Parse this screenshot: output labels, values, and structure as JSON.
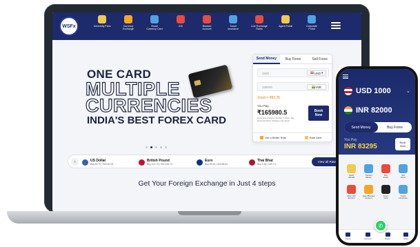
{
  "site": {
    "logo_text": "WSFx"
  },
  "nav": {
    "items": [
      {
        "label": "University Fees",
        "icon": "university-icon",
        "color": "#f2c94c"
      },
      {
        "label": "Currency\nExchange",
        "icon": "coins-icon",
        "color": "#f5a623"
      },
      {
        "label": "Smart\nCurrency Card",
        "icon": "card-icon",
        "color": "#4fa3e0"
      },
      {
        "label": "GIC",
        "icon": "handshake-icon",
        "color": "#e94b3c"
      },
      {
        "label": "Blocked\nAccount",
        "icon": "euro-icon",
        "color": "#e94b3c"
      },
      {
        "label": "Travel\nInsurance",
        "icon": "shield-icon",
        "color": "#4fa3e0"
      },
      {
        "label": "Live Exchange\nRates",
        "icon": "chart-icon",
        "color": "#e94b3c"
      },
      {
        "label": "Agent Portal",
        "icon": "agent-icon",
        "color": "#f2c94c"
      },
      {
        "label": "Corporate\nPortal",
        "icon": "building-icon",
        "color": "#4fa3e0"
      }
    ]
  },
  "hero": {
    "line1": "ONE CARD",
    "line2": "MULTIPLE",
    "line3": "CURRENCIES",
    "line4": "INDIA'S BEST FOREX CARD"
  },
  "widget": {
    "tabs": [
      "Send Money",
      "Buy Forex",
      "Sell Forex"
    ],
    "send_placeholder": "3600",
    "send_currency": "USD",
    "receive_placeholder": "338000",
    "receive_currency": "INR",
    "rate": "1Usd = ₹82.25",
    "you_pay_label": "You Pay",
    "you_pay_value": "₹165980.5",
    "fine_print": "Excluding charges (Charge ₹ 400+) Tax, Documentation Charges may Apply",
    "book_label": "Book\nNow",
    "better_rate": "Get a Better Rate",
    "rate_alert": "Rate Alert"
  },
  "rates": [
    {
      "name": "US Dollar",
      "values": "Buy 82.75 | Sell 82.25",
      "color": "#3c5fb0"
    },
    {
      "name": "British Pound",
      "values": "Buy 101.70 | Sell 100.74",
      "color": "#c8102e"
    },
    {
      "name": "Euro",
      "values": "Buy 89.40 | Sell 88.64",
      "color": "#003399"
    },
    {
      "name": "Thai Bhat",
      "values": "Buy 2.46 | Sell 2.4",
      "color": "#a51931"
    }
  ],
  "view_all": "View all Rates",
  "steps_heading": "Get Your Foreign Exchange in Just 4 steps",
  "phone": {
    "from_amount": "USD 1000",
    "to_amount": "INR 82000",
    "tabs": [
      "Send Money",
      "Buy Forex"
    ],
    "you_pay_label": "You Pay",
    "you_pay_value": "INR 83295",
    "book_label": "Book\nNow",
    "grid": [
      {
        "label": "Study\nAbroad",
        "color": "#f2c94c"
      },
      {
        "label": "Transfer\nMoney",
        "color": "#4fa3e0"
      },
      {
        "label": "Buy\nForex",
        "color": "#e94b3c"
      },
      {
        "label": "Sell\nForex",
        "color": "#4fa3e0"
      },
      {
        "label": "Open GIC\nAccount",
        "color": "#e94b3c"
      },
      {
        "label": "Open Blocked\nAccount",
        "color": "#f5a623"
      },
      {
        "label": "Forex\nCard",
        "color": "#222222"
      },
      {
        "label": "Travel\nInsurance",
        "color": "#4fa3e0"
      }
    ],
    "nav": [
      "Home",
      "Account",
      "Rates",
      "More"
    ]
  },
  "colors": {
    "brand": "#1d2a6b",
    "accent": "#e07a12",
    "whatsapp": "#25d366"
  }
}
